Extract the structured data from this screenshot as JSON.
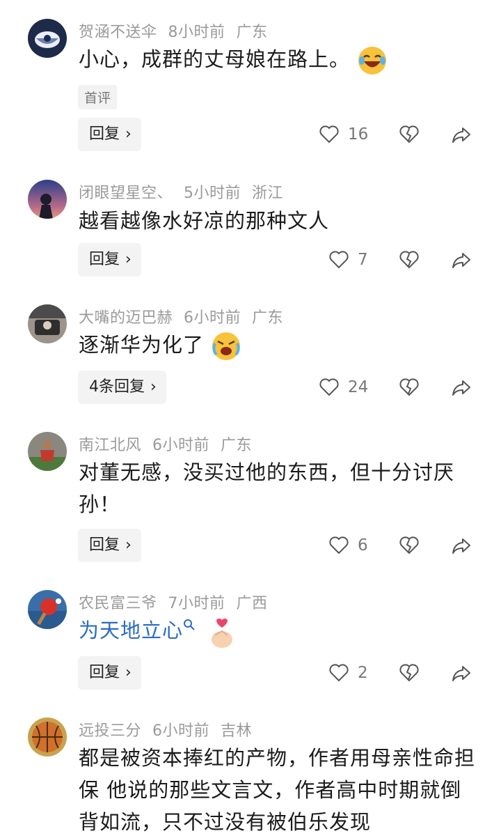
{
  "comments": [
    {
      "user": "贺涵不送伞",
      "time": "8小时前",
      "location": "广东",
      "text": "小心，成群的丈母娘在路上。",
      "tag": "首评",
      "reply_label": "回复",
      "likes": "16",
      "avatar_colors": [
        "#1e2a4a",
        "#9aa7c4"
      ]
    },
    {
      "user": "闭眼望星空、",
      "time": "5小时前",
      "location": "浙江",
      "text": "越看越像水好凉的那种文人",
      "reply_label": "回复",
      "likes": "7",
      "avatar_colors": [
        "#2b3f8a",
        "#e79a7a"
      ]
    },
    {
      "user": "大嘴的迈巴赫",
      "time": "6小时前",
      "location": "广东",
      "text": "逐渐华为化了",
      "reply_label": "4条回复",
      "likes": "24",
      "avatar_colors": [
        "#4b4b4b",
        "#c9c2b8"
      ]
    },
    {
      "user": "南江北风",
      "time": "6小时前",
      "location": "广东",
      "text": "对董无感，没买过他的东西，但十分讨厌孙！",
      "reply_label": "回复",
      "likes": "6",
      "avatar_colors": [
        "#6d6a63",
        "#c23a2e"
      ]
    },
    {
      "user": "农民富三爷",
      "time": "7小时前",
      "location": "广西",
      "text": "为天地立心",
      "reply_label": "回复",
      "likes": "2",
      "avatar_colors": [
        "#3a6ea8",
        "#d9312a"
      ]
    },
    {
      "user": "远投三分",
      "time": "6小时前",
      "location": "吉林",
      "text": "都是被资本捧红的产物，作者用母亲性命担保 他说的那些文言文，作者高中时期就倒背如流，只不过没有被伯乐发现",
      "avatar_colors": [
        "#c8a24f",
        "#d0702a"
      ]
    }
  ]
}
